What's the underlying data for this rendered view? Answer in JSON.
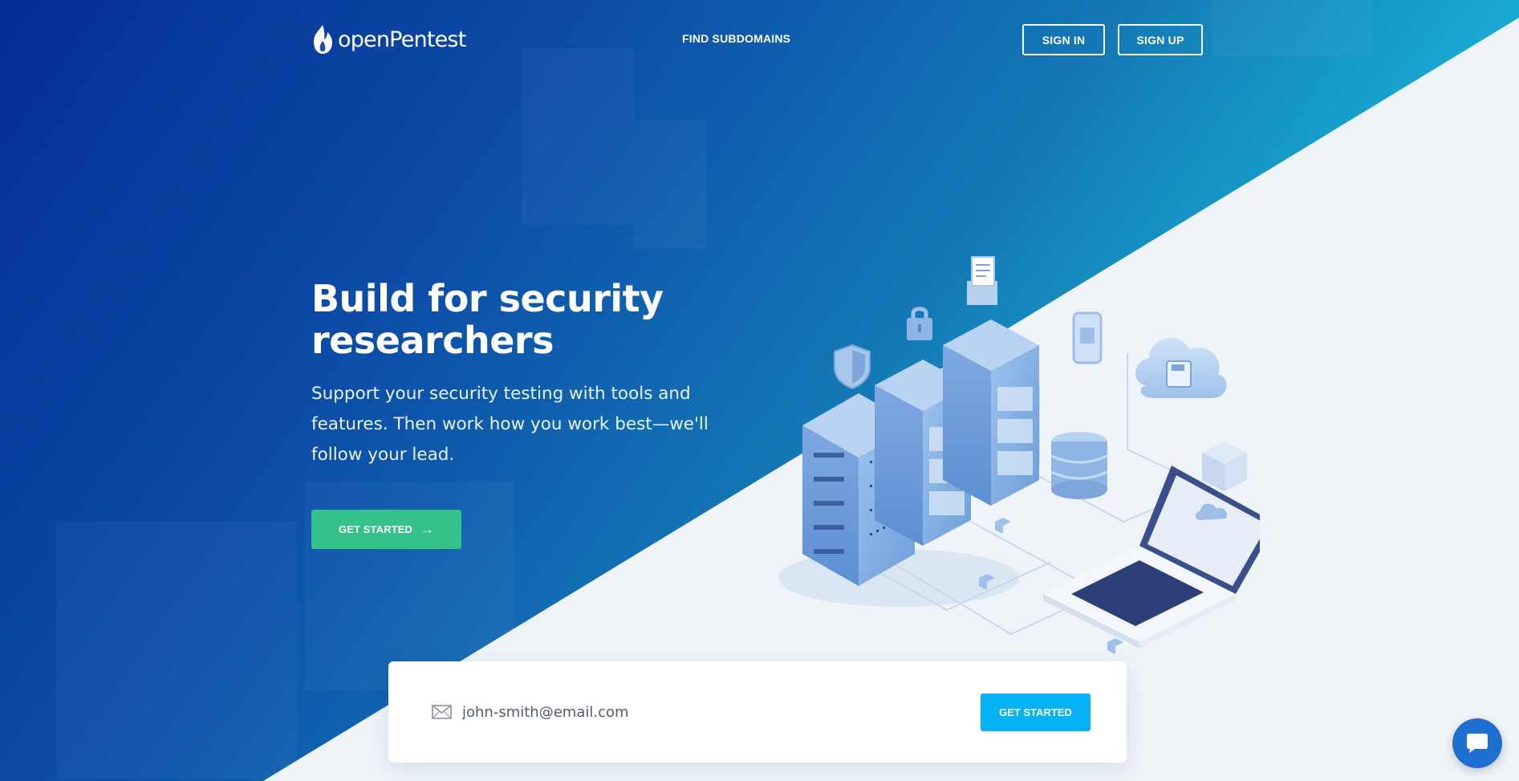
{
  "brand": {
    "name": "openPentest"
  },
  "nav": {
    "find_subdomains": "FIND SUBDOMAINS",
    "sign_in": "SIGN IN",
    "sign_up": "SIGN UP"
  },
  "hero": {
    "title": "Build for security researchers",
    "description": "Support your security testing with tools and features. Then work how you work best—we'll follow your lead.",
    "cta_label": "GET STARTED",
    "cta_arrow": "→"
  },
  "signup": {
    "email_value": "john-smith@email.com",
    "button_label": "GET STARTED"
  },
  "icons": {
    "logo": "flame-icon",
    "email": "envelope-icon",
    "chat": "chat-bubble-icon"
  },
  "colors": {
    "primary_gradient_start": "#052d95",
    "primary_gradient_end": "#1cb6d7",
    "cta_green": "#34c28a",
    "cta_blue": "#05b3f5",
    "chat_blue": "#1f6fd1"
  }
}
